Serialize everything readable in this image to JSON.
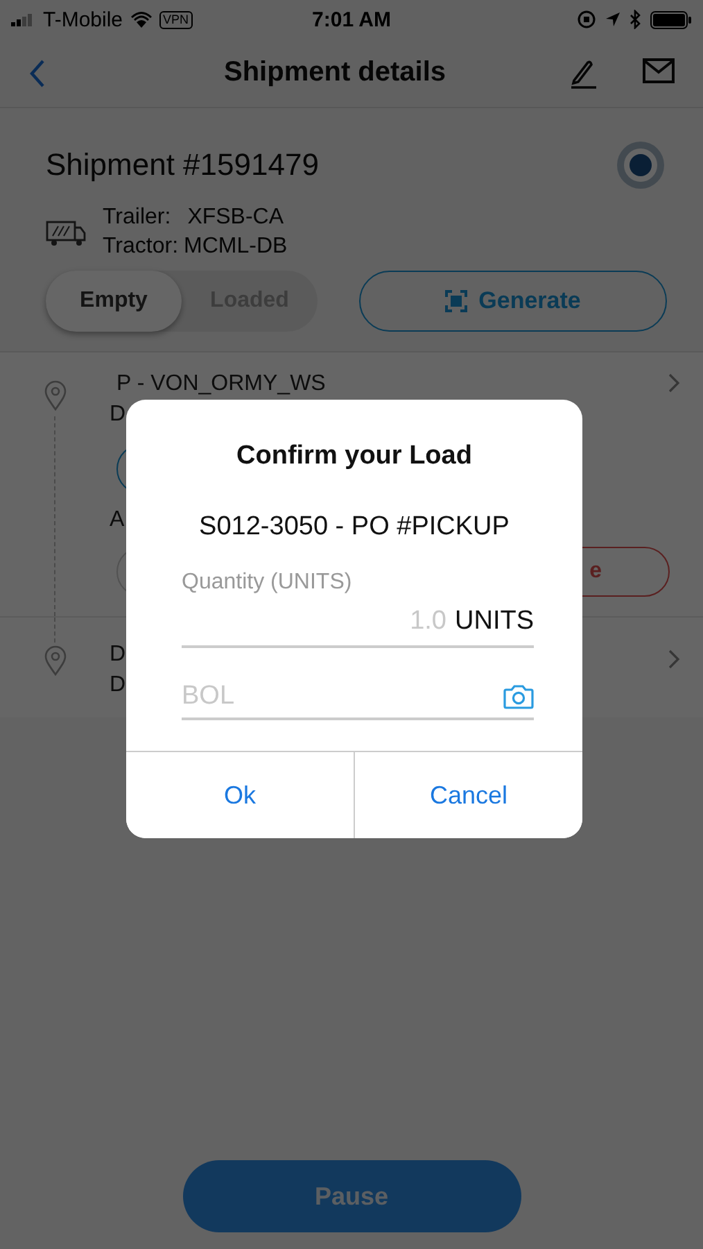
{
  "status_bar": {
    "carrier": "T-Mobile",
    "vpn": "VPN",
    "time": "7:01 AM"
  },
  "nav": {
    "title": "Shipment details"
  },
  "shipment": {
    "title": "Shipment #1591479",
    "trailer_label": "Trailer:",
    "trailer": "XFSB-CA",
    "tractor_label": "Tractor:",
    "tractor": "MCML-DB",
    "toggle": [
      {
        "label": "Empty",
        "selected": true
      },
      {
        "label": "Loaded",
        "selected": false
      }
    ],
    "generate": "Generate"
  },
  "stops": [
    {
      "title": "P - VON_ORMY_WS",
      "line_1": "D",
      "line_2": "A",
      "action": "e"
    },
    {
      "line_1": "D",
      "line_2": "D"
    }
  ],
  "dialog": {
    "title": "Confirm your Load",
    "subtitle": "S012-3050 - PO #PICKUP",
    "quantity": {
      "label": "Quantity (UNITS)",
      "placeholder": "1.0",
      "unit": "UNITS"
    },
    "bol": {
      "placeholder": "BOL"
    },
    "buttons": [
      "Ok",
      "Cancel"
    ]
  },
  "pause": "Pause"
}
